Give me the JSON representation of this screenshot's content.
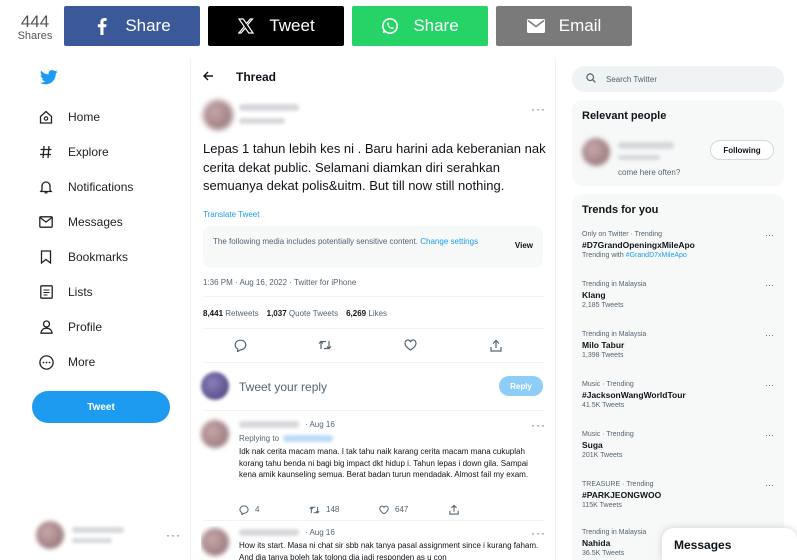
{
  "share_bar": {
    "count": "444",
    "count_label": "Shares",
    "buttons": [
      {
        "label": "Share",
        "icon": "facebook-icon",
        "color": "#3b5998"
      },
      {
        "label": "Tweet",
        "icon": "x-icon",
        "color": "#000000"
      },
      {
        "label": "Share",
        "icon": "whatsapp-icon",
        "color": "#25d366"
      },
      {
        "label": "Email",
        "icon": "email-icon",
        "color": "#7a7a7a"
      }
    ]
  },
  "nav": {
    "items": [
      {
        "label": "Home",
        "icon": "home-icon"
      },
      {
        "label": "Explore",
        "icon": "hashtag-icon"
      },
      {
        "label": "Notifications",
        "icon": "bell-icon"
      },
      {
        "label": "Messages",
        "icon": "envelope-icon"
      },
      {
        "label": "Bookmarks",
        "icon": "bookmark-icon"
      },
      {
        "label": "Lists",
        "icon": "list-icon"
      },
      {
        "label": "Profile",
        "icon": "person-icon"
      },
      {
        "label": "More",
        "icon": "more-circle-icon"
      }
    ],
    "tweet_button": "Tweet",
    "accent": "#1d9bf0"
  },
  "thread": {
    "header": "Thread",
    "tweet_text": "Lepas 1 tahun lebih kes ni . Baru harini ada keberanian nak cerita dekat public. Selamani diamkan diri serahkan semuanya dekat polis&uitm. But till now still nothing.",
    "translate": "Translate Tweet",
    "sensitive_text": "The following media includes potentially sensitive content.",
    "sensitive_link": "Change settings",
    "view_label": "View",
    "meta": "1:36 PM · Aug 16, 2022 · Twitter for iPhone",
    "retweets": "8,441",
    "retweets_label": "Retweets",
    "quotes": "1,037",
    "quotes_label": "Quote Tweets",
    "likes": "6,269",
    "likes_label": "Likes",
    "reply_placeholder": "Tweet your reply",
    "reply_button": "Reply",
    "replies": [
      {
        "date": "· Aug 16",
        "replying_to": "Replying to",
        "text": "Idk nak cerita macam mana. I tak tahu naik karang cerita macam mana cukuplah korang tahu benda ni bagi big impact dkt hidup i. Tahun lepas i down gila. Sampai kena amik kaunseling semua. Berat badan turun mendadak. Almost fail my exam.",
        "replies": "4",
        "retweets": "148",
        "likes": "647"
      },
      {
        "date": "· Aug 16",
        "text": "How its start. Masa ni chat sir sbb nak tanya pasal assignment since i kurang faham. And dia tanya boleh tak tolong dia jadi responden as u con"
      }
    ]
  },
  "right": {
    "search_placeholder": "Search Twitter",
    "relevant_title": "Relevant people",
    "following_label": "Following",
    "bio": "come here often?",
    "trends_title": "Trends for you",
    "trends": [
      {
        "context": "Only on Twitter · Trending",
        "name": "#D7GrandOpeningxMileApo",
        "sub_prefix": "Trending with ",
        "sub_highlight": "#GrandD7xMileApo"
      },
      {
        "context": "Trending in Malaysia",
        "name": "Klang",
        "sub": "2,185 Tweets"
      },
      {
        "context": "Trending in Malaysia",
        "name": "Milo Tabur",
        "sub": "1,398 Tweets"
      },
      {
        "context": "Music · Trending",
        "name": "#JacksonWangWorldTour",
        "sub": "41.5K Tweets"
      },
      {
        "context": "Music · Trending",
        "name": "Suga",
        "sub": "201K Tweets"
      },
      {
        "context": "TREASURE · Trending",
        "name": "#PARKJEONGWOO",
        "sub": "115K Tweets"
      },
      {
        "context": "Trending in Malaysia",
        "name": "Nahida",
        "sub": "36.5K Tweets"
      }
    ],
    "messages_label": "Messages"
  }
}
